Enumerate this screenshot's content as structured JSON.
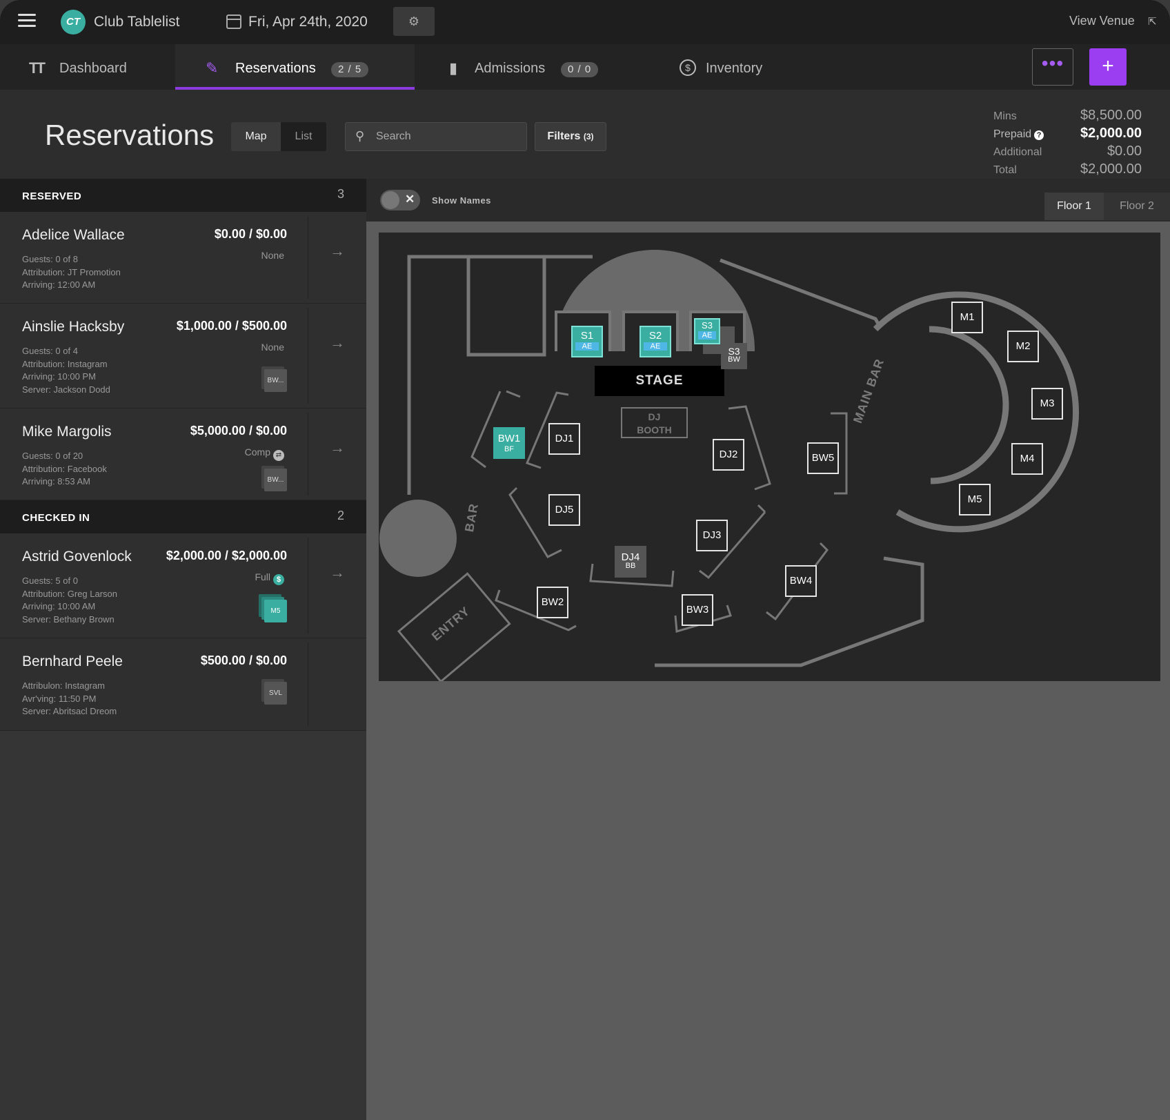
{
  "topbar": {
    "logo_text": "CT",
    "club_name": "Club Tablelist",
    "date": "Fri, Apr 24th, 2020",
    "view_venue": "View Venue",
    "icons": [
      "menu-icon",
      "calendar-icon",
      "gear-icon",
      "external-link-icon"
    ]
  },
  "tabs": [
    {
      "label": "Dashboard",
      "icon": "dashboard-icon"
    },
    {
      "label": "Reservations",
      "badge": "2 / 5",
      "icon": "bottle-icon",
      "active": true
    },
    {
      "label": "Admissions",
      "badge": "0 / 0",
      "icon": "ticket-icon"
    },
    {
      "label": "Inventory",
      "icon": "dollar-circle-icon"
    }
  ],
  "actions": {
    "more": "•••",
    "add": "+"
  },
  "header": {
    "title": "Reservations",
    "view_map": "Map",
    "view_list": "List",
    "search_placeholder": "Search",
    "filters_label": "Filters",
    "filters_count": "(3)"
  },
  "summary": [
    {
      "label": "Mins",
      "value": "$8,500.00"
    },
    {
      "label": "Prepaid",
      "value": "$2,000.00",
      "bold": true
    },
    {
      "label": "Additional",
      "value": "$0.00"
    },
    {
      "label": "Total",
      "value": "$2,000.00"
    }
  ],
  "sections": {
    "reserved": {
      "title": "RESERVED",
      "count": "3"
    },
    "checked_in": {
      "title": "CHECKED IN",
      "count": "2"
    }
  },
  "reservations": [
    {
      "name": "Adelice Wallace",
      "amount": "$0.00 / $0.00",
      "payment": "None",
      "details": [
        "Guests: 0 of 8",
        "Attribution: JT Promotion",
        "Arriving: 12:00 AM"
      ]
    },
    {
      "name": "Ainslie Hacksby",
      "amount": "$1,000.00 / $500.00",
      "payment": "None",
      "chip": "BW...",
      "details": [
        "Guests: 0 of 4",
        "Attribution: Instagram",
        "Arriving: 10:00 PM",
        "Server: Jackson Dodd"
      ]
    },
    {
      "name": "Mike Margolis",
      "amount": "$5,000.00 / $0.00",
      "payment": "Comp",
      "chip": "BW...",
      "details": [
        "Guests: 0 of 20",
        "Attribution: Facebook",
        "Arriving: 8:53 AM"
      ]
    },
    {
      "name": "Astrid Govenlock",
      "amount": "$2,000.00 / $2,000.00",
      "payment": "Full",
      "chip": "M5",
      "details": [
        "Guests: 5 of 0",
        "Attribution: Greg Larson",
        "Arriving: 10:00 AM",
        "Server: Bethany Brown"
      ]
    },
    {
      "name": "Bernhard Peele",
      "amount": "$500.00 / $0.00",
      "payment": "",
      "chip": "SVL",
      "details": [
        "Attribulon: Instagram",
        "Avr'ving: 11:50 PM",
        "Server: Abritsacl Dreom"
      ]
    }
  ],
  "map_toolbar": {
    "show_names": "Show Names",
    "floor1": "Floor 1",
    "floor2": "Floor 2"
  },
  "map": {
    "stage": "STAGE",
    "dj_booth_1": "DJ",
    "dj_booth_2": "BOOTH",
    "main_bar": "MAIN BAR",
    "bar": "BAR",
    "entry": "ENTRY",
    "tables": {
      "S1": {
        "label": "S1",
        "code": "AE"
      },
      "S2": {
        "label": "S2",
        "code": "AE"
      },
      "S3a": {
        "label": "S3",
        "code": "AE"
      },
      "S3b": {
        "label": "S3",
        "code": "BW"
      },
      "BW1": {
        "label": "BW1",
        "code": "BF"
      },
      "DJ1": {
        "label": "DJ1"
      },
      "DJ2": {
        "label": "DJ2"
      },
      "DJ3": {
        "label": "DJ3"
      },
      "DJ4": {
        "label": "DJ4",
        "code": "BB"
      },
      "DJ5": {
        "label": "DJ5"
      },
      "BW2": {
        "label": "BW2"
      },
      "BW3": {
        "label": "BW3"
      },
      "BW4": {
        "label": "BW4"
      },
      "BW5": {
        "label": "BW5"
      },
      "M1": {
        "label": "M1"
      },
      "M2": {
        "label": "M2"
      },
      "M3": {
        "label": "M3"
      },
      "M4": {
        "label": "M4"
      },
      "M5": {
        "label": "M5"
      }
    }
  }
}
